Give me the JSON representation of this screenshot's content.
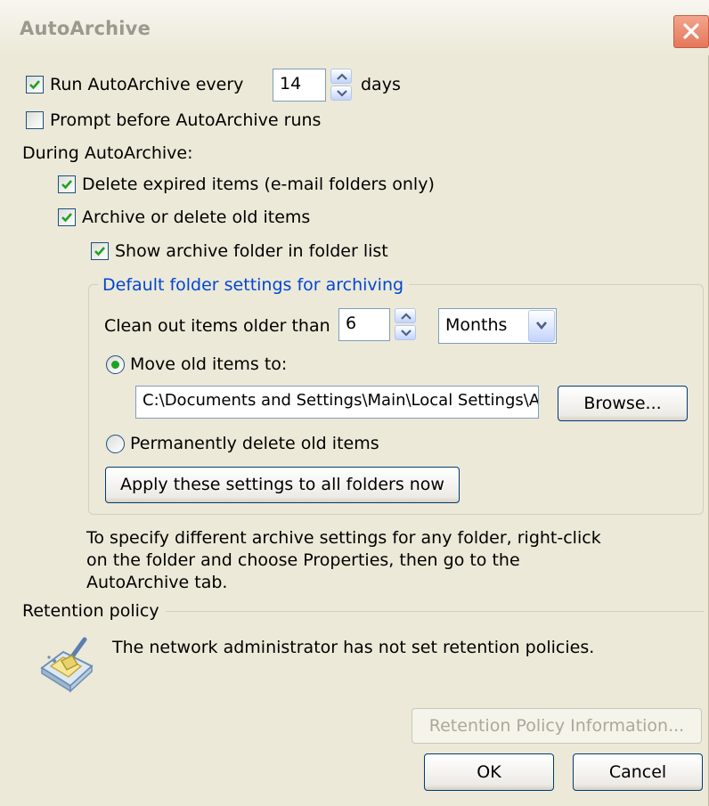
{
  "window": {
    "title": "AutoArchive"
  },
  "run_autoarchive": {
    "label": "Run AutoArchive every",
    "checked": true,
    "value": "14",
    "unit": "days"
  },
  "prompt_before": {
    "label": "Prompt before AutoArchive runs",
    "checked": false
  },
  "during_label": "During AutoArchive:",
  "delete_expired": {
    "label": "Delete expired items (e-mail folders only)",
    "checked": true
  },
  "archive_old": {
    "label": "Archive or delete old items",
    "checked": true
  },
  "show_folder": {
    "label": "Show archive folder in folder list",
    "checked": true
  },
  "default_group": {
    "legend": "Default folder settings for archiving",
    "clean_label": "Clean out items older than",
    "clean_value": "6",
    "period": "Months",
    "move_label": "Move old items to:",
    "move_selected": true,
    "path": "C:\\Documents and Settings\\Main\\Local Settings\\Application Data\\Microsoft\\Outlook\\archive.pst",
    "browse_label": "Browse...",
    "delete_label": "Permanently delete old items",
    "apply_label": "Apply these settings to all folders now"
  },
  "info_text": {
    "line1": "To specify different archive settings for any folder, right-click",
    "line2": "on the folder and choose Properties, then go to the",
    "line3": "AutoArchive tab."
  },
  "retention": {
    "label": "Retention policy",
    "message": "The network administrator has not set retention policies.",
    "info_button": "Retention Policy Information..."
  },
  "buttons": {
    "ok": "OK",
    "cancel": "Cancel"
  },
  "colors": {
    "accent_check": "#21a121",
    "group_legend": "#0046d5",
    "dialog_bg": "#ece9d8"
  }
}
